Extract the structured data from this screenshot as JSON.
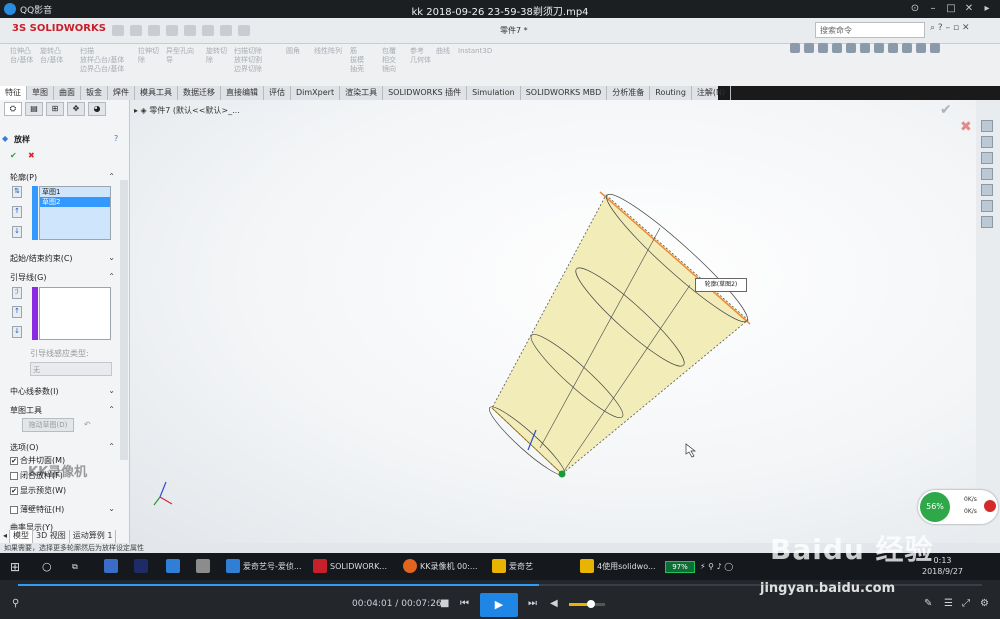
{
  "player": {
    "app_name": "QQ影音",
    "file_title": "kk 2018-09-26 23-59-38剃须刀.mp4",
    "time_current": "00:04:01",
    "time_separator": "/",
    "time_total": "00:07:26",
    "progress": 0.54,
    "volume": 0.62
  },
  "sw": {
    "brand": "SOLIDWORKS",
    "doc_title": "零件7 *",
    "search_placeholder": "搜索命令",
    "cmd_groups": [
      {
        "lines": [
          "拉伸凸",
          "台/基体"
        ]
      },
      {
        "lines": [
          "旋转凸",
          "台/基体"
        ]
      },
      {
        "lines": [
          "扫描",
          "放样凸台/基体",
          "边界凸台/基体"
        ]
      },
      {
        "lines": [
          "拉伸切",
          "除"
        ]
      },
      {
        "lines": [
          "异型孔向",
          "导"
        ]
      },
      {
        "lines": [
          "旋转切",
          "除"
        ]
      },
      {
        "lines": [
          "扫描切除",
          "放样切割",
          "边界切除"
        ]
      },
      {
        "lines": [
          "圆角"
        ]
      },
      {
        "lines": [
          "线性阵列"
        ]
      },
      {
        "lines": [
          "筋",
          "拔模",
          "抽壳"
        ]
      },
      {
        "lines": [
          "包覆",
          "相交",
          "镜向"
        ]
      },
      {
        "lines": [
          "参考",
          "几何体"
        ]
      },
      {
        "lines": [
          "曲线"
        ]
      },
      {
        "lines": [
          "Instant3D"
        ]
      }
    ],
    "tabs": [
      "特征",
      "草图",
      "曲面",
      "钣金",
      "焊件",
      "模具工具",
      "数据迁移",
      "直接编辑",
      "评估",
      "DimXpert",
      "渲染工具",
      "SOLIDWORKS 插件",
      "Simulation",
      "SOLIDWORKS MBD",
      "分析准备",
      "Routing",
      "注解(N)"
    ],
    "active_tab": 0,
    "tree_root": "零件7 (默认<<默认>_...",
    "status_text": "如果需要，选择更多轮廓然后为放样设定属性",
    "callout": "轮廓(草图2)"
  },
  "panel": {
    "feature_name": "放样",
    "help": "?",
    "ok": "✔",
    "cancel": "✖",
    "profiles_label": "轮廓(P)",
    "profiles": [
      "草图1",
      "草图2"
    ],
    "selected_profile": 1,
    "start_end_label": "起始/结束约束(C)",
    "guides_label": "引导线(G)",
    "guide_type_label": "引导线感应类型:",
    "guide_type_value": "无",
    "centerline_label": "中心线参数(I)",
    "sketch_tools_label": "草图工具",
    "drag_sketch_button": "拖动草图(D)",
    "options_label": "选项(O)",
    "merge_tangent": "合并切面(M)",
    "closed_loft": "闭合放样(F)",
    "show_preview": "显示预览(W)",
    "thin_feature": "薄壁特征(H)",
    "curvature_label": "曲率显示(Y)",
    "bottom_tabs": [
      "模型",
      "3D 视图",
      "运动算例 1"
    ]
  },
  "taskbar": {
    "items": [
      "爱奇艺号-爱侦...",
      "SOLIDWORK...",
      "KK录像机 00:...",
      "爱奇艺",
      "4使用solidwo..."
    ],
    "battery": "97%",
    "time": "0:13",
    "date": "2018/9/27"
  },
  "overlays": {
    "net_percent": "56%",
    "net_up": "0K/s",
    "net_down": "0K/s",
    "watermark": "KK录像机",
    "baidu_logo": "Baidu 经验",
    "baidu_url": "jingyan.baidu.com"
  },
  "colors": {
    "sw_red": "#c8202a",
    "loft_fill": "#f2ecb8",
    "profile_orange": "#f08a3a",
    "accent_blue": "#1f86e6"
  }
}
